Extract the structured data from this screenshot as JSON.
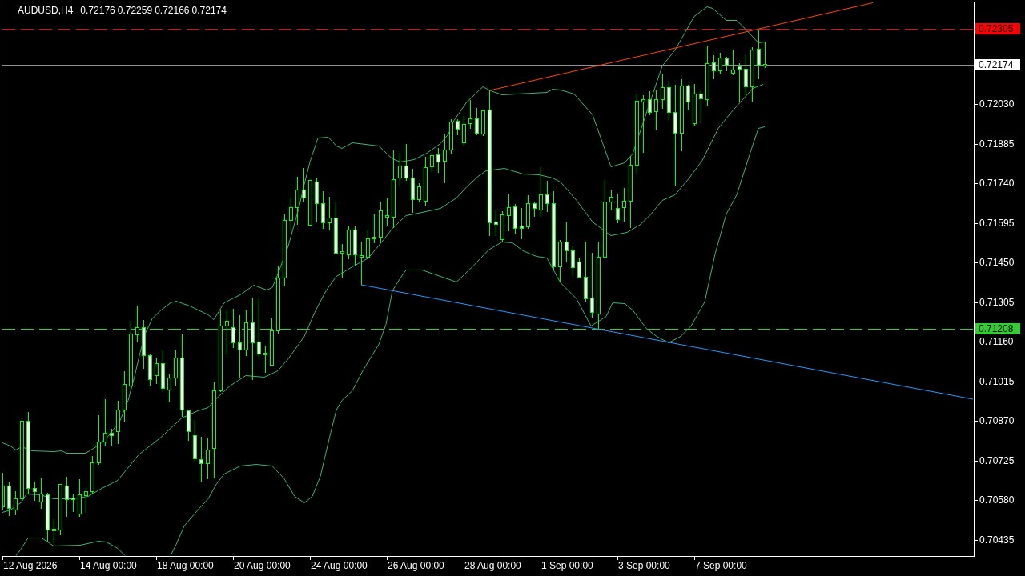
{
  "chart": {
    "symbol": "AUDUSD,H4",
    "quotes": [
      "0.72176",
      "0.72259",
      "0.72166",
      "0.72174"
    ]
  },
  "price_lines": [
    {
      "kind": "level",
      "label": "0.72305",
      "color": "#ff0000"
    },
    {
      "kind": "current",
      "label": "0.72174",
      "color": "#ffffff"
    },
    {
      "kind": "level",
      "label": "0.71208",
      "color": "#32cd32"
    }
  ],
  "price_axis": {
    "labels": [
      "0.72030",
      "0.71885",
      "0.71740",
      "0.71595",
      "0.71450",
      "0.71305",
      "0.71160",
      "0.71015",
      "0.70870",
      "0.70725",
      "0.70580",
      "0.70435"
    ]
  },
  "time_axis": {
    "labels": [
      "12 Aug 2026",
      "14 Aug 00:00",
      "18 Aug 00:00",
      "20 Aug 00:00",
      "24 Aug 00:00",
      "26 Aug 00:00",
      "28 Aug 00:00",
      "1 Sep 00:00",
      "3 Sep 00:00",
      "7 Sep 00:00"
    ]
  }
}
